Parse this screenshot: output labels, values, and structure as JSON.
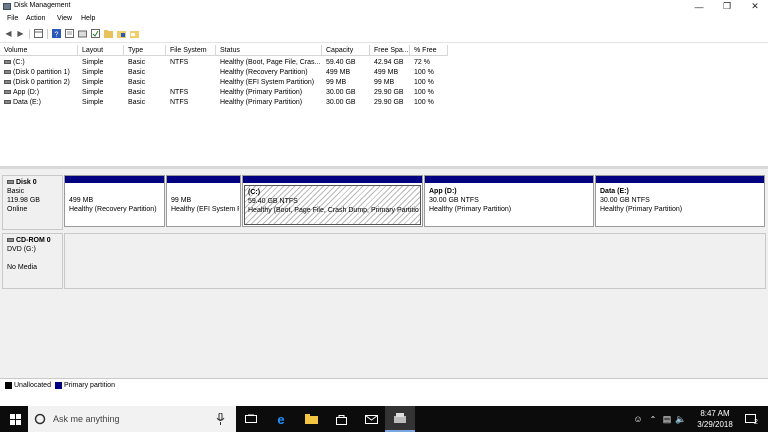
{
  "window": {
    "title": "Disk Management",
    "minimize": "—",
    "maximize": "❐",
    "close": "✕"
  },
  "menu": [
    "File",
    "Action",
    "View",
    "Help"
  ],
  "table": {
    "headers": [
      "Volume",
      "Layout",
      "Type",
      "File System",
      "Status",
      "Capacity",
      "Free Spa...",
      "% Free"
    ],
    "rows": [
      [
        "(C:)",
        "Simple",
        "Basic",
        "NTFS",
        "Healthy (Boot, Page File, Cras...",
        "59.40 GB",
        "42.94 GB",
        "72 %"
      ],
      [
        "(Disk 0 partition 1)",
        "Simple",
        "Basic",
        "",
        "Healthy (Recovery Partition)",
        "499 MB",
        "499 MB",
        "100 %"
      ],
      [
        "(Disk 0 partition 2)",
        "Simple",
        "Basic",
        "",
        "Healthy (EFI System Partition)",
        "99 MB",
        "99 MB",
        "100 %"
      ],
      [
        "App (D:)",
        "Simple",
        "Basic",
        "NTFS",
        "Healthy (Primary Partition)",
        "30.00 GB",
        "29.90 GB",
        "100 %"
      ],
      [
        "Data (E:)",
        "Simple",
        "Basic",
        "NTFS",
        "Healthy (Primary Partition)",
        "30.00 GB",
        "29.90 GB",
        "100 %"
      ]
    ]
  },
  "disk0": {
    "name": "Disk 0",
    "type": "Basic",
    "size": "119.98 GB",
    "status": "Online",
    "partitions": [
      {
        "title": "",
        "size": "499 MB",
        "status": "Healthy (Recovery Partition)"
      },
      {
        "title": "",
        "size": "99 MB",
        "status": "Healthy (EFI System P"
      },
      {
        "title": "(C:)",
        "size": "59.40 GB NTFS",
        "status": "Healthy (Boot, Page File, Crash Dump, Primary Partitio"
      },
      {
        "title": "App  (D:)",
        "size": "30.00 GB NTFS",
        "status": "Healthy (Primary Partition)"
      },
      {
        "title": "Data  (E:)",
        "size": "30.00 GB NTFS",
        "status": "Healthy (Primary Partition)"
      }
    ]
  },
  "cdrom0": {
    "name": "CD-ROM 0",
    "type": "DVD (G:)",
    "status": "No Media"
  },
  "legend": {
    "unallocated": "Unallocated",
    "primary": "Primary partition",
    "unallocated_color": "#000000",
    "primary_color": "#000080"
  },
  "taskbar": {
    "search_placeholder": "Ask me anything",
    "time": "8:47 AM",
    "date": "3/29/2018",
    "notifications": "2"
  }
}
